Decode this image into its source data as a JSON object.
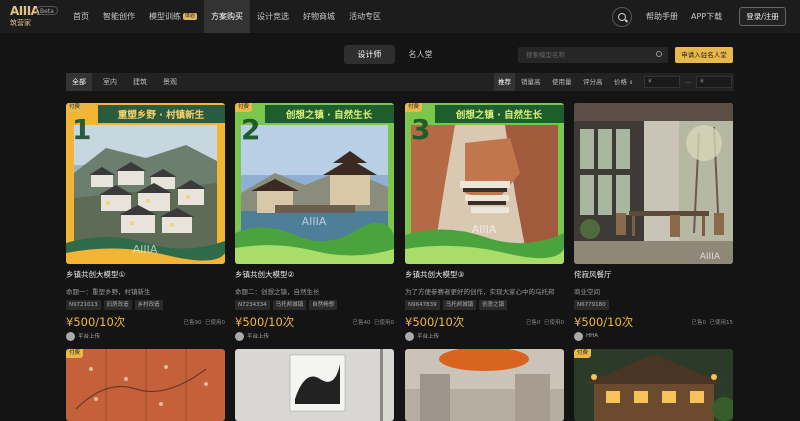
{
  "brand": {
    "logo_text": "AIIIA",
    "logo_sub": "筑营家",
    "beta": "Beta"
  },
  "nav": {
    "items": [
      {
        "label": "首页"
      },
      {
        "label": "智能创作"
      },
      {
        "label": "模型训练",
        "badge": "体验"
      },
      {
        "label": "方案购买",
        "active": true
      },
      {
        "label": "设计竞选"
      },
      {
        "label": "好物商城"
      },
      {
        "label": "活动专区"
      }
    ],
    "help": "帮助手册",
    "app": "APP下载",
    "login": "登录/注册"
  },
  "segment": {
    "designer": "设计师",
    "hall": "名人堂"
  },
  "search": {
    "placeholder": "搜索模型名称"
  },
  "apply_button": "申请入驻名人堂",
  "filter": {
    "tabs": [
      "全部",
      "室内",
      "建筑",
      "景观"
    ],
    "sorts": [
      "推荐",
      "销量高",
      "使用量",
      "评分高",
      "价格"
    ],
    "price_sort_icon": "sort-arrows-icon",
    "price_min_placeholder": "¥",
    "price_separator": "—",
    "price_max_placeholder": "¥"
  },
  "cards": [
    {
      "badge": "付费",
      "banner": "重塑乡野 · 村镇新生",
      "number": "1",
      "title": "乡镇共创大模型①",
      "desc": "命题一：重塑乡野，村镇新生",
      "tags": [
        "N9721013",
        "旧房改造",
        "乡村改造"
      ],
      "price": "¥500/10次",
      "sold": "已售90",
      "used": "已使用0",
      "uploader": "平台上传",
      "theme": "#f0b33a",
      "watermark": "AIIIA"
    },
    {
      "badge": "付费",
      "banner": "创想之镇 · 自然生长",
      "number": "2",
      "title": "乡镇共创大模型②",
      "desc": "命题二：创想之镇，自然生长",
      "tags": [
        "N7234334",
        "乌托邦城镇",
        "自然畅想"
      ],
      "price": "¥500/10次",
      "sold": "已售40",
      "used": "已使用0",
      "uploader": "平台上传",
      "theme": "#79c64a",
      "watermark": "AIIIA"
    },
    {
      "badge": "付费",
      "banner": "创想之镇 · 自然生长",
      "number": "3",
      "title": "乡镇共创大模型③",
      "desc": "为了方便参赛者更好的创作，实现大家心中的乌托邦",
      "tags": [
        "N9647839",
        "乌托邦城镇",
        "创意之镇"
      ],
      "price": "¥500/10次",
      "sold": "已售0",
      "used": "已使用0",
      "uploader": "平台上传",
      "theme": "#79c64a",
      "watermark": "AIIIA"
    },
    {
      "badge": "",
      "banner": "",
      "number": "",
      "title": "侘寂风餐厅",
      "desc": "商业空间",
      "tags": [
        "N6779180"
      ],
      "price": "¥500/10次",
      "sold": "已售0",
      "used": "已使用15",
      "uploader": "HHA",
      "theme": "#8a7a62",
      "watermark": "AIIIA"
    }
  ],
  "row2": [
    {
      "badge": "付费"
    },
    {
      "badge": ""
    },
    {
      "badge": ""
    },
    {
      "badge": "付费"
    }
  ]
}
